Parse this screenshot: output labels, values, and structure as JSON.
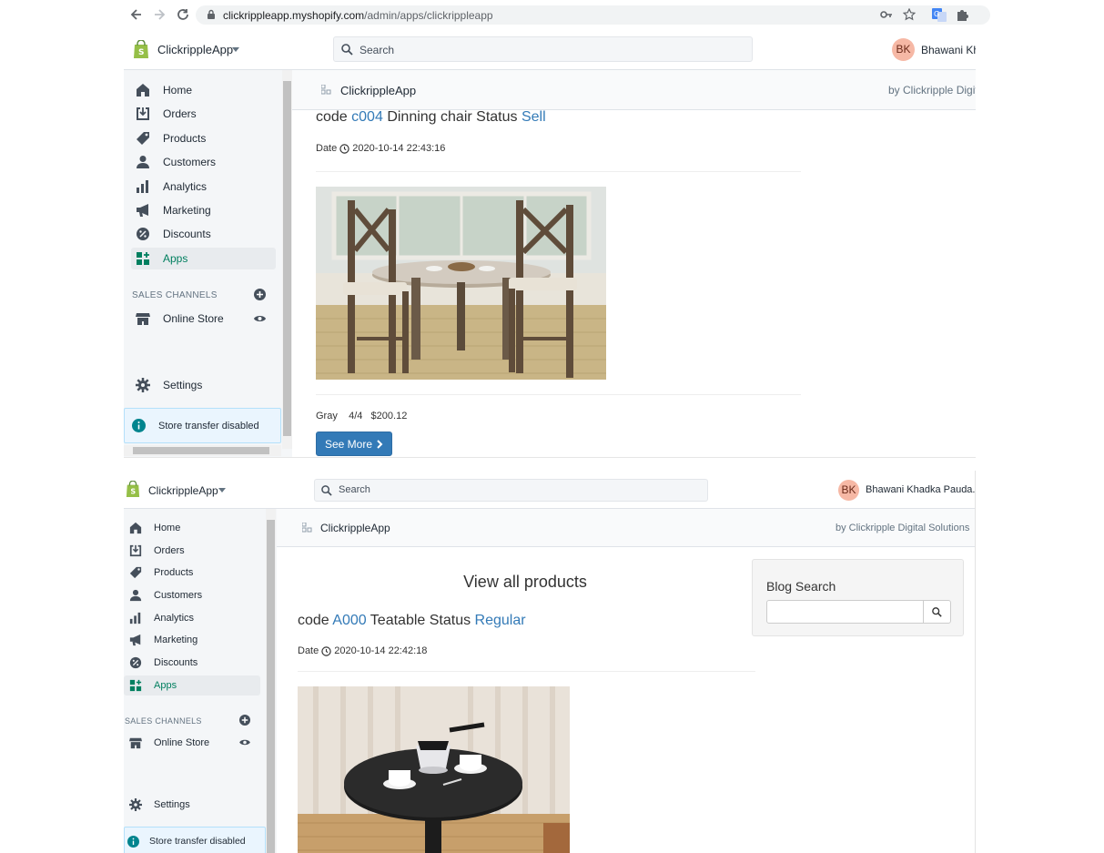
{
  "browser": {
    "url_host": "clickrippleapp.myshopify.com",
    "url_path": "/admin/apps/clickrippleapp"
  },
  "panels": [
    {
      "store_name": "ClickrippleApp",
      "search_placeholder": "Search",
      "user_initials": "BK",
      "user_name": "Bhawani Kha",
      "nav": [
        "Home",
        "Orders",
        "Products",
        "Customers",
        "Analytics",
        "Marketing",
        "Discounts",
        "Apps"
      ],
      "sales_channels_label": "SALES CHANNELS",
      "online_store_label": "Online Store",
      "settings_label": "Settings",
      "banner_text": "Store transfer disabled",
      "app_title": "ClickrippleApp",
      "by_text": "by Clickripple Digita",
      "post": {
        "prefix": "code",
        "code": "c004",
        "name": "Dinning chair Status",
        "status": "Sell",
        "date_label": "Date",
        "date": "2020-10-14 22:43:16",
        "color": "Gray",
        "qty": "4/4",
        "price": "$200.12",
        "button": "See More"
      }
    },
    {
      "store_name": "ClickrippleApp",
      "search_placeholder": "Search",
      "user_initials": "BK",
      "user_name": "Bhawani Khadka Pauda...",
      "nav": [
        "Home",
        "Orders",
        "Products",
        "Customers",
        "Analytics",
        "Marketing",
        "Discounts",
        "Apps"
      ],
      "sales_channels_label": "SALES CHANNELS",
      "online_store_label": "Online Store",
      "settings_label": "Settings",
      "banner_text": "Store transfer disabled",
      "app_title": "ClickrippleApp",
      "by_text": "by Clickripple Digital Solutions",
      "view_all": "View all products",
      "blog_search_title": "Blog Search",
      "post": {
        "prefix": "code",
        "code": "A000",
        "name": "Teatable Status",
        "status": "Regular",
        "date_label": "Date",
        "date": "2020-10-14 22:42:18"
      }
    }
  ],
  "colors": {
    "accent_green": "#007f5f",
    "link_blue": "#337ab7",
    "shopify_green": "#95bf47"
  }
}
